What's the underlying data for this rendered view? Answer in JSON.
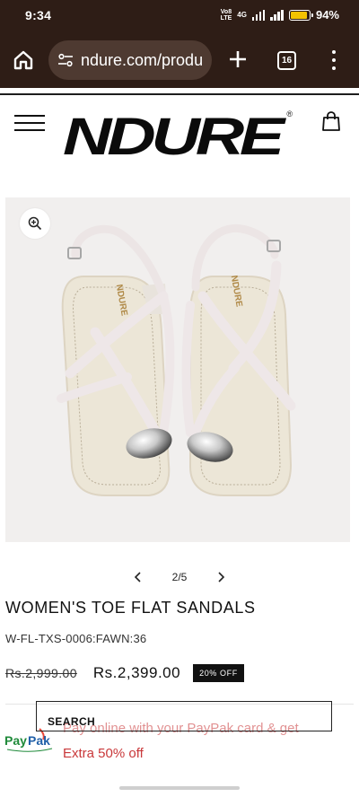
{
  "status_bar": {
    "time": "9:34",
    "volte": "VoB\nLTE",
    "network": "4G",
    "battery_percent_label": "94%",
    "battery_level": 0.94,
    "battery_color": "#f2c200"
  },
  "browser": {
    "url": "ndure.com/produ",
    "tab_count": "16",
    "icons": [
      "home-icon",
      "tune-icon",
      "plus-icon",
      "tabs-icon",
      "more-vert-icon"
    ]
  },
  "header": {
    "logo_text": "NDURE",
    "logo_registered": "®",
    "icons": [
      "hamburger-menu-icon",
      "shopping-bag-icon"
    ]
  },
  "gallery": {
    "current": "2/5",
    "zoom_icon": "zoom-in-icon",
    "prev_icon": "chevron-left-icon",
    "next_icon": "chevron-right-icon",
    "sandal_brand_text": "NDURE"
  },
  "product": {
    "title": "WOMEN'S TOE FLAT SANDALS",
    "sku": "W-FL-TXS-0006:FAWN:36",
    "old_price": "Rs.2,999.00",
    "price": "Rs.2,399.00",
    "discount_badge": "20% OFF"
  },
  "overlay": {
    "search_label": "SEARCH",
    "paypak_logo": "PayPak",
    "paypak_line1": "Pay online with your PayPak card & get",
    "paypak_line2": "Extra 50% off"
  },
  "colors": {
    "browser_chrome": "#2e1d16",
    "url_pill": "#4e3a31",
    "promo_red": "#c9383a",
    "badge_black": "#111111"
  }
}
